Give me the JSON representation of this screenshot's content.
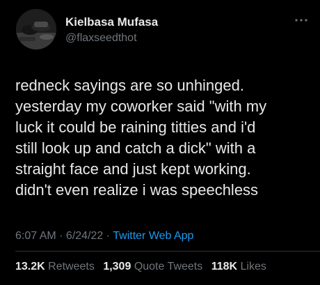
{
  "author": {
    "display_name": "Kielbasa Mufasa",
    "handle": "@flaxseedthot"
  },
  "tweet": {
    "lines": [
      "redneck sayings are so unhinged.",
      "yesterday my coworker said \"with my",
      "luck it could be raining titties and i'd",
      "still look up and catch a dick\" with a",
      "straight face and just kept working.",
      "didn't even realize i was speechless"
    ]
  },
  "meta": {
    "time": "6:07 AM",
    "sep1": " · ",
    "date": "6/24/22",
    "sep2": " · ",
    "source": "Twitter Web App"
  },
  "stats": {
    "retweets_count": "13.2K",
    "retweets_label": "Retweets",
    "quote_count": "1,309",
    "quote_label": "Quote Tweets",
    "likes_count": "118K",
    "likes_label": "Likes"
  },
  "icons": {
    "more": "more-options-icon"
  },
  "colors": {
    "background": "#000000",
    "primary_text": "#e7e9ea",
    "secondary_text": "#71767b",
    "link": "#1d9bf0",
    "divider": "#2f3336"
  }
}
